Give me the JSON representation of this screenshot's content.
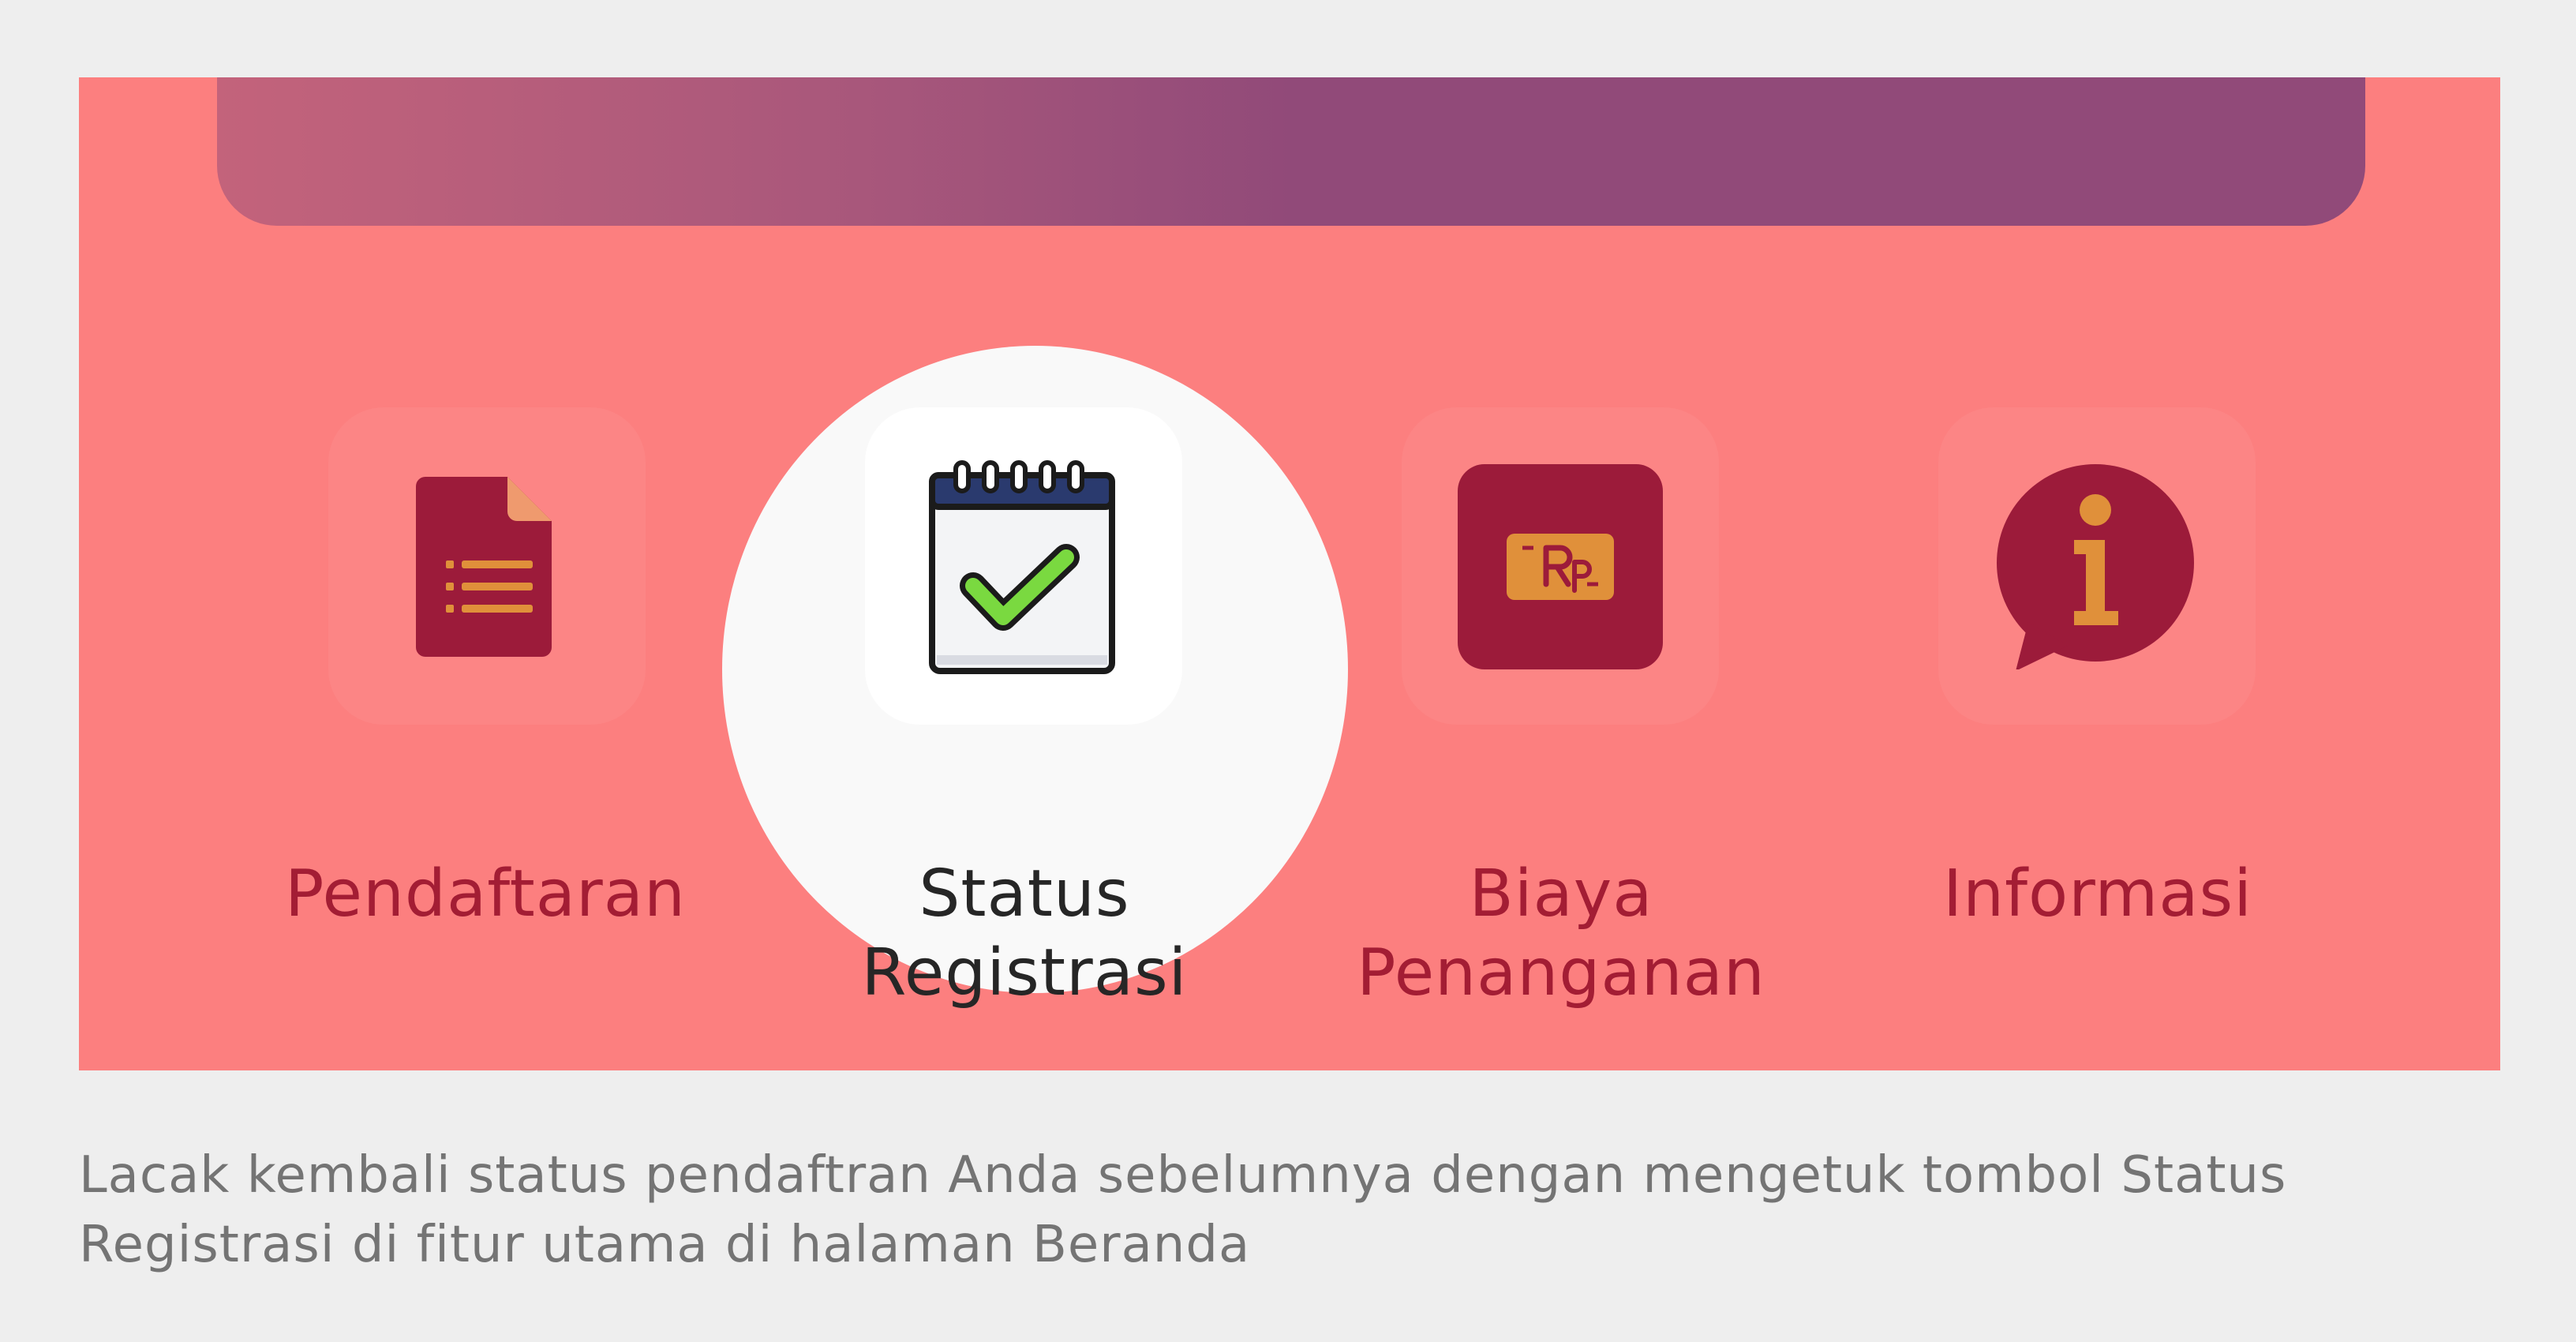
{
  "features": [
    {
      "id": "pendaftaran",
      "label": "Pendaftaran",
      "icon": "document-list-icon"
    },
    {
      "id": "status",
      "label": "Status\nRegistrasi",
      "icon": "calendar-check-icon",
      "active": true
    },
    {
      "id": "biaya",
      "label": "Biaya\nPenanganan",
      "icon": "rupiah-money-icon"
    },
    {
      "id": "informasi",
      "label": "Informasi",
      "icon": "info-chat-icon"
    }
  ],
  "caption": "Lacak kembali status pendaftran Anda sebelumnya dengan mengetuk tombol Status Registrasi di fitur utama di halaman Beranda",
  "colors": {
    "panel": "#fc7f7f",
    "icon_primary": "#9c1b3a",
    "icon_accent": "#e0903a",
    "check": "#7ad940",
    "label": "#a31d34"
  }
}
